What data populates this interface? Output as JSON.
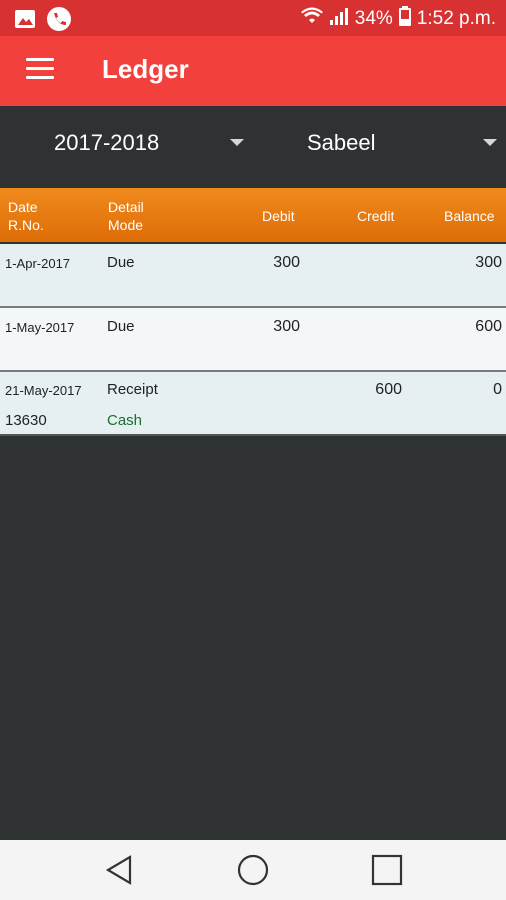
{
  "status_bar": {
    "battery": "34%",
    "time": "1:52 p.m.",
    "icons": [
      "image-icon",
      "phone-icon",
      "wifi-icon",
      "signal-icon",
      "battery-icon"
    ]
  },
  "app_bar": {
    "title": "Ledger",
    "menu_icon": "hamburger-menu-icon"
  },
  "filters": {
    "year": "2017-2018",
    "account": "Sabeel"
  },
  "table": {
    "headers": {
      "date": "Date",
      "rno": "R.No.",
      "detail": "Detail",
      "mode": "Mode",
      "debit": "Debit",
      "credit": "Credit",
      "balance": "Balance"
    },
    "rows": [
      {
        "date": "1-Apr-2017",
        "rno": "",
        "detail": "Due",
        "mode": "",
        "debit": "300",
        "credit": "",
        "balance": "300"
      },
      {
        "date": "1-May-2017",
        "rno": "",
        "detail": "Due",
        "mode": "",
        "debit": "300",
        "credit": "",
        "balance": "600"
      },
      {
        "date": "21-May-2017",
        "rno": "13630",
        "detail": "Receipt",
        "mode": "Cash",
        "debit": "",
        "credit": "600",
        "balance": "0"
      }
    ]
  },
  "colors": {
    "status_bar": "#d83131",
    "app_bar": "#f2403d",
    "header_orange": "#f08a1c",
    "row_alt": "#e6eff2",
    "row": "#f3f7f9",
    "background": "#2f3233",
    "cash_text": "#1d6e2f"
  },
  "nav_bar": {
    "icons": [
      "back-icon",
      "home-icon",
      "recents-icon"
    ]
  }
}
